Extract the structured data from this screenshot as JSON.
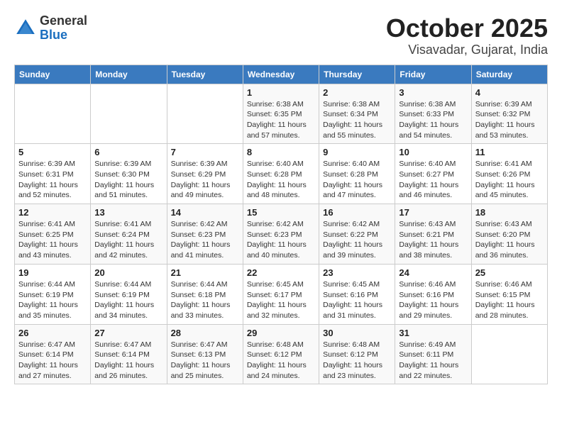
{
  "header": {
    "logo_line1": "General",
    "logo_line2": "Blue",
    "title": "October 2025",
    "subtitle": "Visavadar, Gujarat, India"
  },
  "days_of_week": [
    "Sunday",
    "Monday",
    "Tuesday",
    "Wednesday",
    "Thursday",
    "Friday",
    "Saturday"
  ],
  "weeks": [
    [
      {
        "day": "",
        "info": ""
      },
      {
        "day": "",
        "info": ""
      },
      {
        "day": "",
        "info": ""
      },
      {
        "day": "1",
        "info": "Sunrise: 6:38 AM\nSunset: 6:35 PM\nDaylight: 11 hours and 57 minutes."
      },
      {
        "day": "2",
        "info": "Sunrise: 6:38 AM\nSunset: 6:34 PM\nDaylight: 11 hours and 55 minutes."
      },
      {
        "day": "3",
        "info": "Sunrise: 6:38 AM\nSunset: 6:33 PM\nDaylight: 11 hours and 54 minutes."
      },
      {
        "day": "4",
        "info": "Sunrise: 6:39 AM\nSunset: 6:32 PM\nDaylight: 11 hours and 53 minutes."
      }
    ],
    [
      {
        "day": "5",
        "info": "Sunrise: 6:39 AM\nSunset: 6:31 PM\nDaylight: 11 hours and 52 minutes."
      },
      {
        "day": "6",
        "info": "Sunrise: 6:39 AM\nSunset: 6:30 PM\nDaylight: 11 hours and 51 minutes."
      },
      {
        "day": "7",
        "info": "Sunrise: 6:39 AM\nSunset: 6:29 PM\nDaylight: 11 hours and 49 minutes."
      },
      {
        "day": "8",
        "info": "Sunrise: 6:40 AM\nSunset: 6:28 PM\nDaylight: 11 hours and 48 minutes."
      },
      {
        "day": "9",
        "info": "Sunrise: 6:40 AM\nSunset: 6:28 PM\nDaylight: 11 hours and 47 minutes."
      },
      {
        "day": "10",
        "info": "Sunrise: 6:40 AM\nSunset: 6:27 PM\nDaylight: 11 hours and 46 minutes."
      },
      {
        "day": "11",
        "info": "Sunrise: 6:41 AM\nSunset: 6:26 PM\nDaylight: 11 hours and 45 minutes."
      }
    ],
    [
      {
        "day": "12",
        "info": "Sunrise: 6:41 AM\nSunset: 6:25 PM\nDaylight: 11 hours and 43 minutes."
      },
      {
        "day": "13",
        "info": "Sunrise: 6:41 AM\nSunset: 6:24 PM\nDaylight: 11 hours and 42 minutes."
      },
      {
        "day": "14",
        "info": "Sunrise: 6:42 AM\nSunset: 6:23 PM\nDaylight: 11 hours and 41 minutes."
      },
      {
        "day": "15",
        "info": "Sunrise: 6:42 AM\nSunset: 6:23 PM\nDaylight: 11 hours and 40 minutes."
      },
      {
        "day": "16",
        "info": "Sunrise: 6:42 AM\nSunset: 6:22 PM\nDaylight: 11 hours and 39 minutes."
      },
      {
        "day": "17",
        "info": "Sunrise: 6:43 AM\nSunset: 6:21 PM\nDaylight: 11 hours and 38 minutes."
      },
      {
        "day": "18",
        "info": "Sunrise: 6:43 AM\nSunset: 6:20 PM\nDaylight: 11 hours and 36 minutes."
      }
    ],
    [
      {
        "day": "19",
        "info": "Sunrise: 6:44 AM\nSunset: 6:19 PM\nDaylight: 11 hours and 35 minutes."
      },
      {
        "day": "20",
        "info": "Sunrise: 6:44 AM\nSunset: 6:19 PM\nDaylight: 11 hours and 34 minutes."
      },
      {
        "day": "21",
        "info": "Sunrise: 6:44 AM\nSunset: 6:18 PM\nDaylight: 11 hours and 33 minutes."
      },
      {
        "day": "22",
        "info": "Sunrise: 6:45 AM\nSunset: 6:17 PM\nDaylight: 11 hours and 32 minutes."
      },
      {
        "day": "23",
        "info": "Sunrise: 6:45 AM\nSunset: 6:16 PM\nDaylight: 11 hours and 31 minutes."
      },
      {
        "day": "24",
        "info": "Sunrise: 6:46 AM\nSunset: 6:16 PM\nDaylight: 11 hours and 29 minutes."
      },
      {
        "day": "25",
        "info": "Sunrise: 6:46 AM\nSunset: 6:15 PM\nDaylight: 11 hours and 28 minutes."
      }
    ],
    [
      {
        "day": "26",
        "info": "Sunrise: 6:47 AM\nSunset: 6:14 PM\nDaylight: 11 hours and 27 minutes."
      },
      {
        "day": "27",
        "info": "Sunrise: 6:47 AM\nSunset: 6:14 PM\nDaylight: 11 hours and 26 minutes."
      },
      {
        "day": "28",
        "info": "Sunrise: 6:47 AM\nSunset: 6:13 PM\nDaylight: 11 hours and 25 minutes."
      },
      {
        "day": "29",
        "info": "Sunrise: 6:48 AM\nSunset: 6:12 PM\nDaylight: 11 hours and 24 minutes."
      },
      {
        "day": "30",
        "info": "Sunrise: 6:48 AM\nSunset: 6:12 PM\nDaylight: 11 hours and 23 minutes."
      },
      {
        "day": "31",
        "info": "Sunrise: 6:49 AM\nSunset: 6:11 PM\nDaylight: 11 hours and 22 minutes."
      },
      {
        "day": "",
        "info": ""
      }
    ]
  ]
}
